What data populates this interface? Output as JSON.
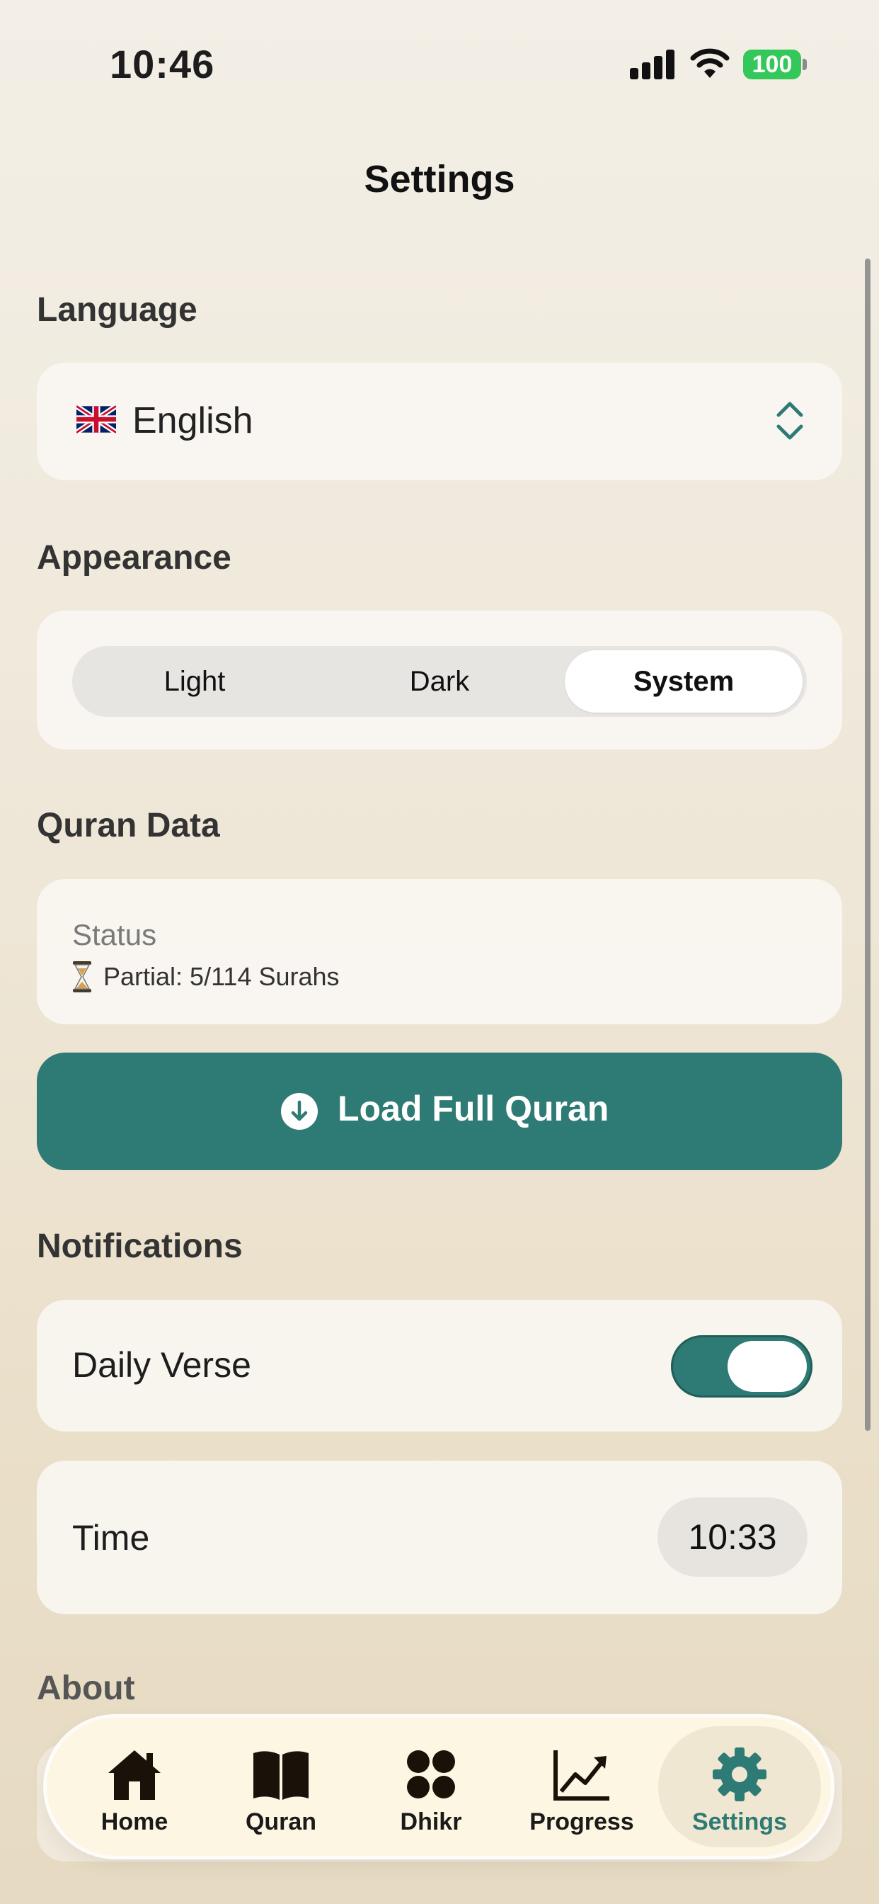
{
  "status_bar": {
    "time": "10:46",
    "battery": "100"
  },
  "header": {
    "title": "Settings"
  },
  "language": {
    "heading": "Language",
    "selected": "English"
  },
  "appearance": {
    "heading": "Appearance",
    "options": [
      "Light",
      "Dark",
      "System"
    ],
    "selected": "System"
  },
  "quran_data": {
    "heading": "Quran Data",
    "status_label": "Status",
    "status_value": "Partial: 5/114 Surahs",
    "load_button": "Load Full Quran"
  },
  "notifications": {
    "heading": "Notifications",
    "daily_verse_label": "Daily Verse",
    "daily_verse_enabled": true,
    "time_label": "Time",
    "time_value": "10:33"
  },
  "about": {
    "heading": "About"
  },
  "tab_bar": {
    "tabs": [
      "Home",
      "Quran",
      "Dhikr",
      "Progress",
      "Settings"
    ],
    "active": "Settings"
  },
  "colors": {
    "accent": "#2e7a74",
    "battery": "#34c759"
  }
}
